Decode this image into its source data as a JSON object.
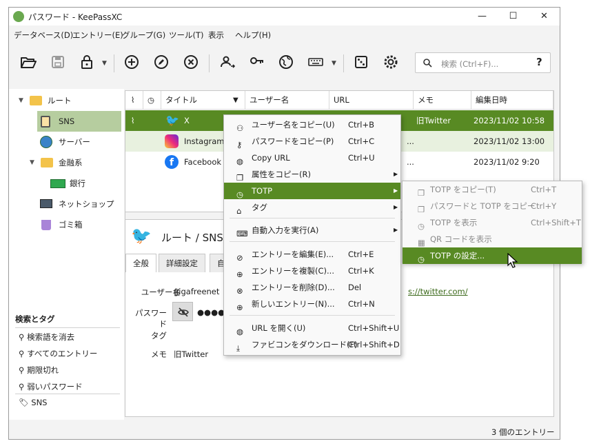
{
  "window": {
    "title": "パスワード - KeePassXC",
    "controls": {
      "minimize": "—",
      "maximize": "☐",
      "close": "✕"
    }
  },
  "menubar": [
    "データベース(D)",
    "エントリー(E)",
    "グループ(G)",
    "ツール(T)",
    "表示",
    "ヘルプ(H)"
  ],
  "toolbar": {
    "search_placeholder": "検索 (Ctrl+F)...",
    "search_help": "?"
  },
  "sidebar": {
    "groups": [
      {
        "label": "ルート"
      },
      {
        "label": "SNS"
      },
      {
        "label": "サーバー"
      },
      {
        "label": "金融系"
      },
      {
        "label": "銀行"
      },
      {
        "label": "ネットショップ"
      },
      {
        "label": "ゴミ箱"
      }
    ],
    "tags_header": "検索とタグ",
    "tags": [
      "検索語を消去",
      "すべてのエントリー",
      "期限切れ",
      "弱いパスワード"
    ],
    "user_tag": "SNS"
  },
  "table": {
    "headers": [
      "タイトル",
      "ユーザー名",
      "URL",
      "メモ",
      "編集日時"
    ],
    "rows": [
      {
        "title": "X",
        "memo": "旧Twitter",
        "modified": "2023/11/02 10:58"
      },
      {
        "title": "Instagram",
        "memo": "...",
        "modified": "2023/11/02 13:00"
      },
      {
        "title": "Facebook",
        "memo": "...",
        "modified": "2023/11/02 9:20"
      }
    ]
  },
  "entry": {
    "path": "ルート / SNS /",
    "tabs": [
      "全般",
      "詳細設定",
      "自"
    ],
    "username_label": "ユーザー名",
    "username": "gigafreenet",
    "password_label": "パスワード",
    "password": "●●●●●",
    "url_fragment": "s://twitter.com/",
    "tags_label": "タグ",
    "memo_label": "メモ",
    "memo": "旧Twitter"
  },
  "status": "3 個のエントリー",
  "context_menu": [
    {
      "label": "ユーザー名をコピー(U)",
      "shortcut": "Ctrl+B"
    },
    {
      "label": "パスワードをコピー(P)",
      "shortcut": "Ctrl+C"
    },
    {
      "label": "Copy URL",
      "shortcut": "Ctrl+U"
    },
    {
      "label": "属性をコピー(R)",
      "shortcut": ""
    },
    {
      "label": "TOTP",
      "shortcut": ""
    },
    {
      "label": "タグ",
      "shortcut": ""
    },
    {
      "label": "自動入力を実行(A)",
      "shortcut": ""
    },
    {
      "label": "エントリーを編集(E)...",
      "shortcut": "Ctrl+E"
    },
    {
      "label": "エントリーを複製(C)...",
      "shortcut": "Ctrl+K"
    },
    {
      "label": "エントリーを削除(D)...",
      "shortcut": "Del"
    },
    {
      "label": "新しいエントリー(N)...",
      "shortcut": "Ctrl+N"
    },
    {
      "label": "URL を開く(U)",
      "shortcut": "Ctrl+Shift+U"
    },
    {
      "label": "ファビコンをダウンロード(F)",
      "shortcut": "Ctrl+Shift+D"
    }
  ],
  "submenu": [
    {
      "label": "TOTP をコピー(T)",
      "shortcut": "Ctrl+T"
    },
    {
      "label": "パスワードと TOTP をコピー",
      "shortcut": "Ctrl+Y"
    },
    {
      "label": "TOTP を表示",
      "shortcut": "Ctrl+Shift+T"
    },
    {
      "label": "QR コードを表示",
      "shortcut": ""
    },
    {
      "label": "TOTP の設定...",
      "shortcut": ""
    }
  ],
  "colors": {
    "accent": "#588a23",
    "selection_light": "#b6cd9f",
    "folder": "#f3c34a"
  }
}
